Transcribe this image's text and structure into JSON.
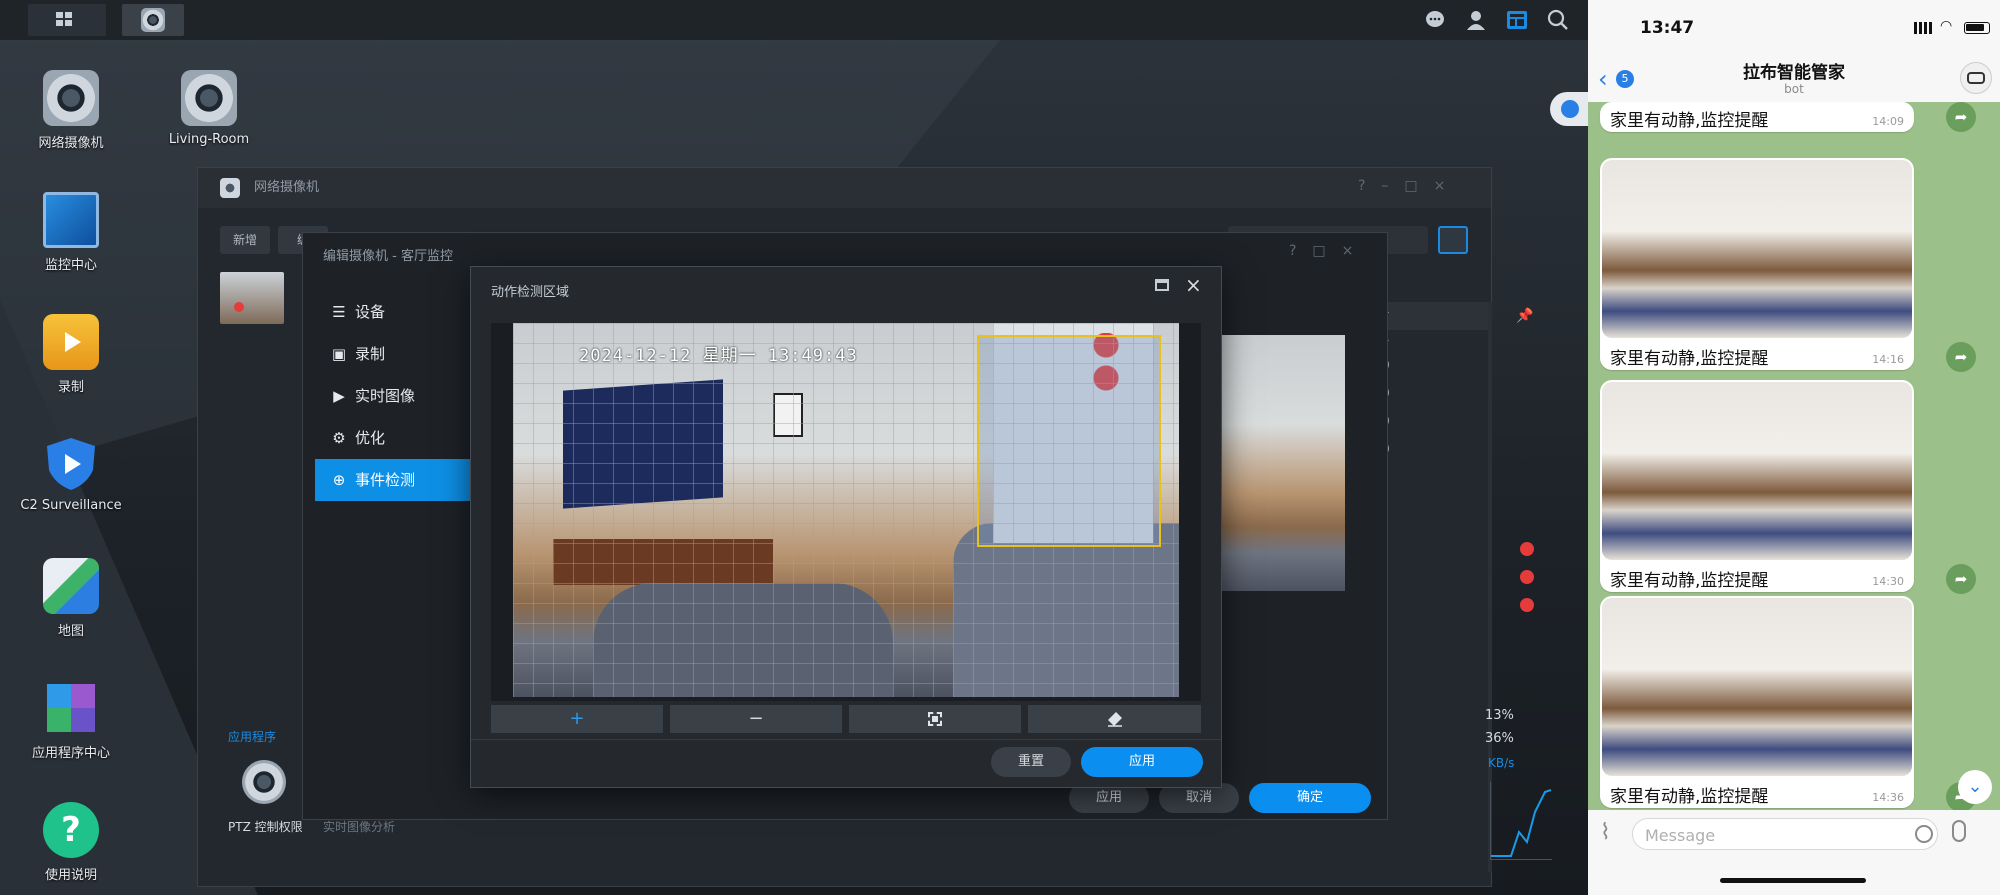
{
  "desktop": {
    "icons": [
      {
        "label": "网络摄像机"
      },
      {
        "label": "Living-Room"
      },
      {
        "label": "监控中心"
      },
      {
        "label": "录制"
      },
      {
        "label": "C2 Surveillance"
      },
      {
        "label": "地图"
      },
      {
        "label": "应用程序中心"
      },
      {
        "label": "使用说明"
      }
    ]
  },
  "main_window": {
    "title": "网络摄像机",
    "toolbar": {
      "add_label": "新增",
      "edit_label": "编"
    },
    "list_counts": [
      "1",
      "1",
      "0",
      "0",
      "0",
      "0"
    ],
    "section_label": "应用程序",
    "ptz_label": "PTZ 控制权限",
    "realtime_analysis_label": "实时图像分析",
    "stats": {
      "cpu": "13%",
      "mem": "36%",
      "net_unit": "KB/s"
    },
    "buttons": {
      "apply": "应用",
      "cancel": "取消",
      "ok": "确定"
    }
  },
  "edit_window": {
    "title": "编辑摄像机 - 客厅监控",
    "menu": [
      {
        "label": "设备",
        "icon": "list-icon"
      },
      {
        "label": "录制",
        "icon": "calendar-check-icon"
      },
      {
        "label": "实时图像",
        "icon": "play-square-icon"
      },
      {
        "label": "优化",
        "icon": "gears-icon"
      },
      {
        "label": "事件检测",
        "icon": "crosshair-icon"
      }
    ],
    "active_index": 4
  },
  "motion_dialog": {
    "title": "动作检测区域",
    "timestamp": "2024-12-12 星期一 13:49:43",
    "tools": [
      "+",
      "−",
      "select-area-icon",
      "eraser-icon"
    ],
    "buttons": {
      "reset": "重置",
      "apply": "应用"
    }
  },
  "phone": {
    "time": "13:47",
    "back_count": "5",
    "chat_title": "拉布智能管家",
    "chat_subtitle": "bot",
    "messages": [
      {
        "text": "家里有动静,监控提醒",
        "time": "14:09"
      },
      {
        "text": "家里有动静,监控提醒",
        "time": "14:16"
      },
      {
        "text": "家里有动静,监控提醒",
        "time": "14:30"
      },
      {
        "text": "家里有动静,监控提醒",
        "time": "14:36"
      }
    ],
    "input_placeholder": "Message"
  },
  "colors": {
    "accent": "#0a8ff0",
    "chat_bg": "#9cc08a",
    "forward": "#6a9e5c"
  }
}
